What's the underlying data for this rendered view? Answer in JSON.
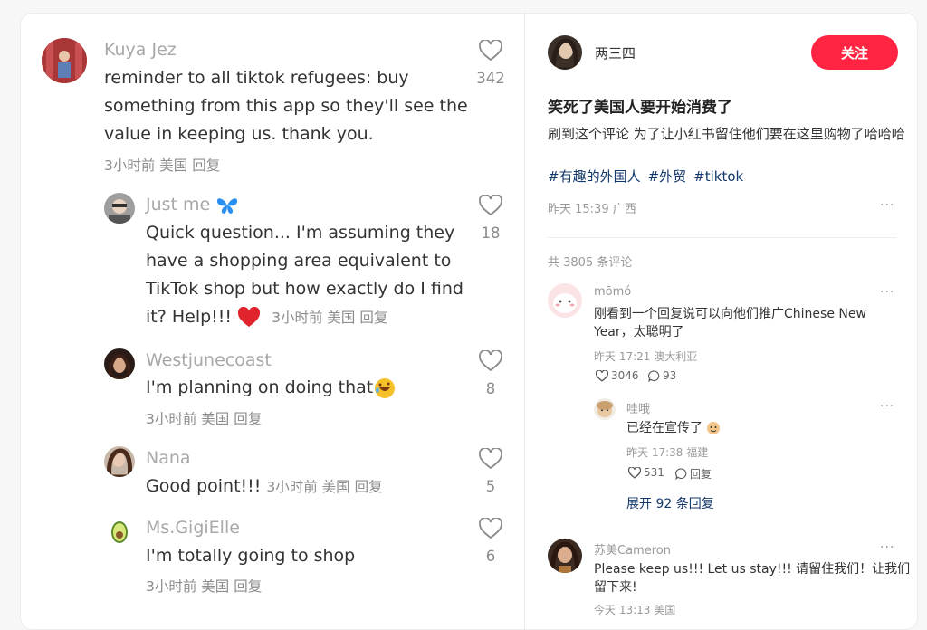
{
  "left_comments": [
    {
      "username": "Kuya Jez",
      "text_lines": [
        "reminder to all tiktok refugees:  buy",
        "something from this app so they'll see the",
        "value in keeping us. thank you."
      ],
      "meta": "3小时前 美国 回复",
      "likes": "342",
      "avatar_color": "#a83a3a"
    },
    {
      "username": "Just me",
      "text_lines": [
        "Quick question... I'm assuming they",
        "have a shopping area equivalent to",
        "TikTok shop but how exactly do I find",
        "it? Help!!!"
      ],
      "meta": "3小时前 美国 回复",
      "likes": "18",
      "emoji_name": "blue-butterfly",
      "heart_emoji": "red-heart"
    },
    {
      "username": "Westjunecoast",
      "text": "I'm planning on doing that",
      "meta": "3小时前 美国 回复",
      "likes": "8",
      "emoji_name": "rolling-laughing"
    },
    {
      "username": "Nana",
      "text": "Good point!!!",
      "meta": "3小时前 美国 回复",
      "likes": "5"
    },
    {
      "username": "Ms.GigiElle",
      "text": "I'm totally going to shop",
      "meta": "3小时前 美国 回复",
      "likes": "6",
      "avatar_icon": "avocado"
    }
  ],
  "post": {
    "author": "两三四",
    "follow_label": "关注",
    "title": "笑死了美国人要开始消费了",
    "body": "刷到这个评论 为了让小红书留住他们要在这里购物了哈哈哈",
    "tags": [
      "#有趣的外国人",
      "#外贸",
      "#tiktok"
    ],
    "date": "昨天 15:39 广西",
    "more": "···",
    "comment_count": "共 3805 条评论"
  },
  "right_comments": [
    {
      "username": "mōmó",
      "text_lines": [
        "刚看到一个回复说可以向他们推广Chinese New",
        "Year，太聪明了"
      ],
      "date": "昨天 17:21 澳大利亚",
      "likes": "3046",
      "replies": "93",
      "more": "···"
    },
    {
      "username": "哇哦",
      "text": "已经在宣传了",
      "date": "昨天 17:38 福建",
      "likes": "531",
      "reply_label": "回复",
      "more": "···",
      "emoji_name": "face-emoji"
    },
    {
      "username": "苏美Cameron",
      "text_lines": [
        "Please keep us!!! Let us stay!!! 请留住我们！让我们",
        "留下来!"
      ],
      "date": "今天 13:13 美国",
      "more": "···"
    }
  ],
  "expand_label": "展开 92 条回复",
  "colors": {
    "accent": "#ff2442",
    "tag": "#13386c",
    "heart_red": "#e0242b",
    "butterfly_blue": "#2a8ff0"
  }
}
